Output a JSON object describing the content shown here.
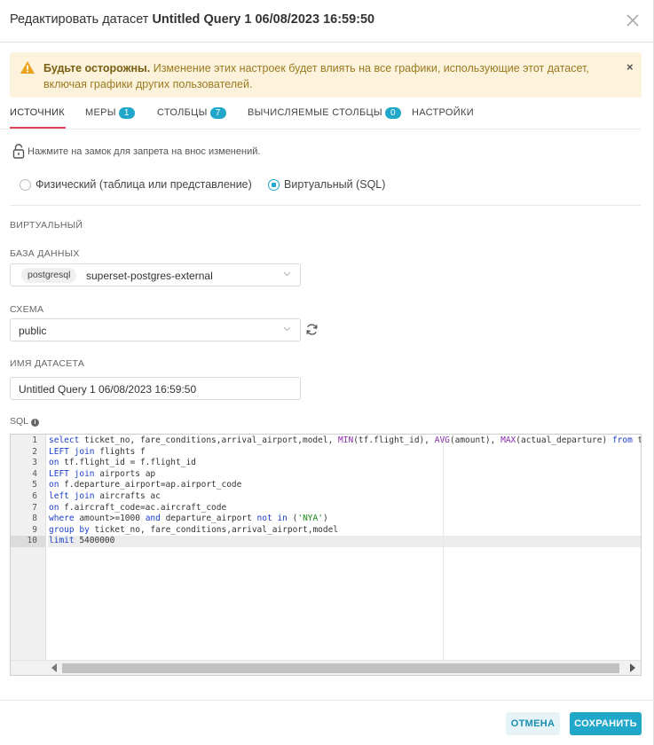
{
  "header": {
    "title_prefix": "Редактировать датасет",
    "title_name": "Untitled Query 1 06/08/2023 16:59:50",
    "close_icon": "close-icon"
  },
  "alert": {
    "bold": "Будьте осторожны.",
    "text": "Изменение этих настроек будет влиять на все графики, использующие этот датасет, включая графики других пользователей.",
    "close": "×",
    "color": "#fdf3dc"
  },
  "tabs": [
    {
      "label": "ИСТОЧНИК",
      "badge": null,
      "active": true
    },
    {
      "label": "МЕРЫ",
      "badge": "1"
    },
    {
      "label": "СТОЛБЦЫ",
      "badge": "7"
    },
    {
      "label": "ВЫЧИСЛЯЕМЫЕ СТОЛБЦЫ",
      "badge": "0"
    },
    {
      "label": "НАСТРОЙКИ",
      "badge": null
    }
  ],
  "lock": {
    "text": "Нажмите на замок для запрета на внос изменений."
  },
  "source_type": {
    "options": [
      "Физический (таблица или представление)",
      "Виртуальный (SQL)"
    ],
    "selected": "Виртуальный (SQL)"
  },
  "virtual_label": "ВИРТУАЛЬНЫЙ",
  "database": {
    "label": "БАЗА ДАННЫХ",
    "tag": "postgresql",
    "value": "superset-postgres-external"
  },
  "schema": {
    "label": "СХЕМА",
    "value": "public"
  },
  "dataset_name": {
    "label": "ИМЯ ДАТАСЕТА",
    "value": "Untitled Query 1 06/08/2023 16:59:50"
  },
  "sql": {
    "label": "SQL",
    "line_numbers": [
      "1",
      "2",
      "3",
      "4",
      "5",
      "6",
      "7",
      "8",
      "9",
      "10"
    ],
    "lines": [
      "select ticket_no, fare_conditions,arrival_airport,model, MIN(tf.flight_id), AVG(amount), MAX(actual_departure) from tick",
      "LEFT join flights f",
      "on tf.flight_id = f.flight_id",
      "LEFT join airports ap",
      "on f.departure_airport=ap.airport_code",
      "left join aircrafts ac",
      "on f.aircraft_code=ac.aircraft_code",
      "where amount>=1000 and departure_airport not in ('NYA')",
      "group by ticket_no, fare_conditions,arrival_airport,model",
      "limit 5400000"
    ],
    "active_line": 10
  },
  "footer": {
    "cancel": "ОТМЕНА",
    "save": "СОХРАНИТЬ"
  },
  "colors": {
    "accent": "#20a7c9",
    "tab_underline": "#e04355"
  }
}
